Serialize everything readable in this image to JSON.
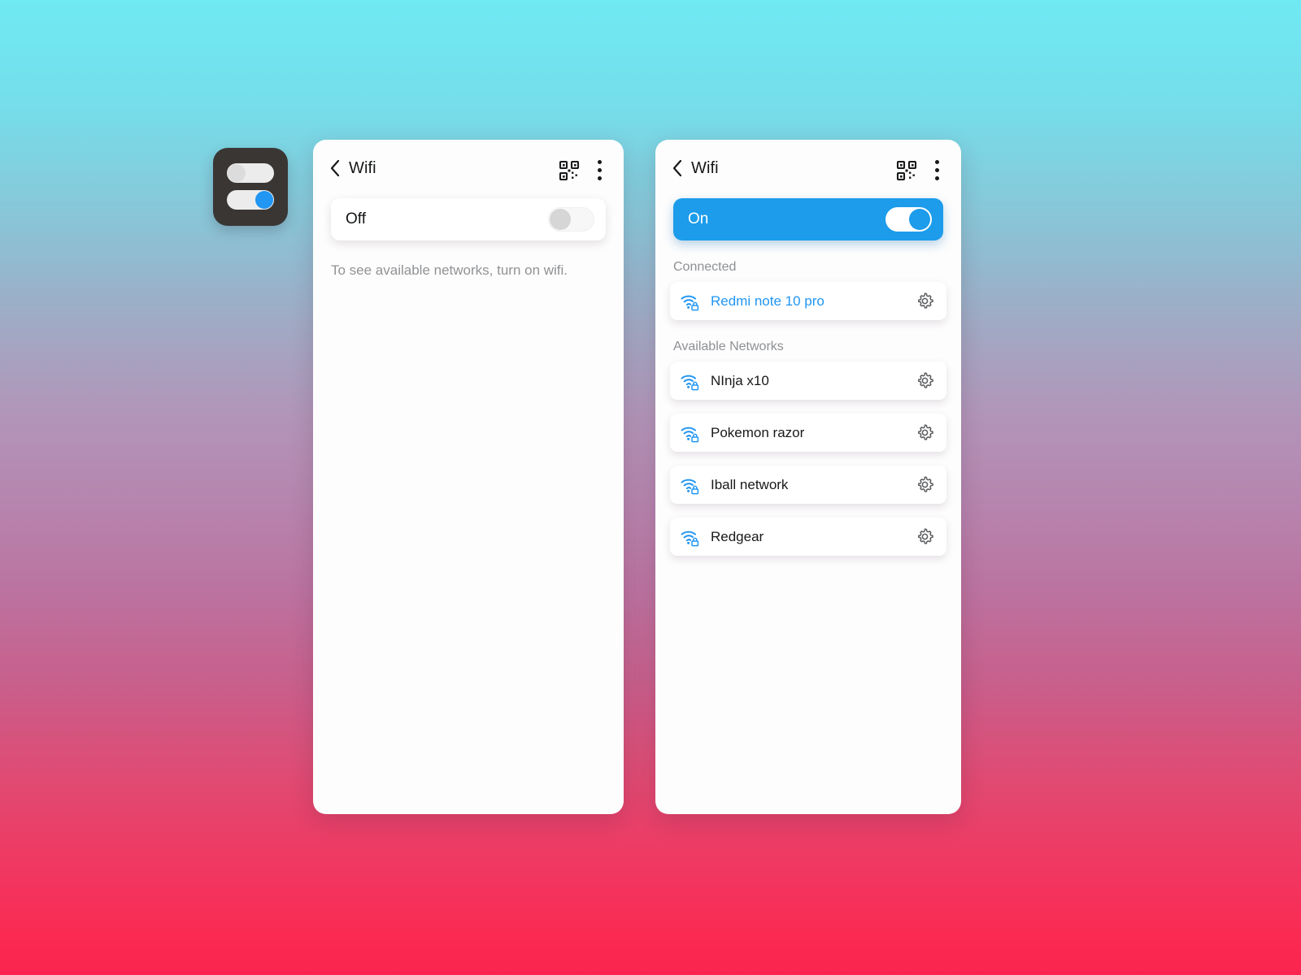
{
  "background": {
    "gradient_top": "#6fe9f3",
    "gradient_mid": "#b384b0",
    "gradient_bottom": "#fb2450"
  },
  "app_tile": {
    "name": "wifi-settings-app-icon",
    "background": "#3a3634",
    "switches": [
      {
        "state": "off",
        "knob_color": "#dcdcdc"
      },
      {
        "state": "on",
        "knob_color": "#2196f3"
      }
    ]
  },
  "screens": [
    {
      "id": "wifi-off-screen",
      "header": {
        "back_icon": "chevron-left-icon",
        "title": "Wifi",
        "qr_icon": "qr-code-icon",
        "menu_icon": "overflow-menu-icon"
      },
      "master_switch": {
        "label": "Off",
        "state": "off"
      },
      "hint": "To see available networks, turn on wifi.",
      "sections": []
    },
    {
      "id": "wifi-on-screen",
      "header": {
        "back_icon": "chevron-left-icon",
        "title": "Wifi",
        "qr_icon": "qr-code-icon",
        "menu_icon": "overflow-menu-icon"
      },
      "master_switch": {
        "label": "On",
        "state": "on",
        "accent_color": "#1c9ceb"
      },
      "hint": "",
      "sections": [
        {
          "label": "Connected",
          "networks": [
            {
              "name": "Redmi note 10 pro",
              "secured": true,
              "connected": true,
              "icon": "wifi-lock-icon",
              "settings_icon": "gear-icon"
            }
          ]
        },
        {
          "label": "Available Networks",
          "networks": [
            {
              "name": "NInja x10",
              "secured": true,
              "connected": false,
              "icon": "wifi-lock-icon",
              "settings_icon": "gear-icon"
            },
            {
              "name": "Pokemon razor",
              "secured": true,
              "connected": false,
              "icon": "wifi-lock-icon",
              "settings_icon": "gear-icon"
            },
            {
              "name": "Iball network",
              "secured": true,
              "connected": false,
              "icon": "wifi-lock-icon",
              "settings_icon": "gear-icon"
            },
            {
              "name": "Redgear",
              "secured": true,
              "connected": false,
              "icon": "wifi-lock-icon",
              "settings_icon": "gear-icon"
            }
          ]
        }
      ]
    }
  ]
}
